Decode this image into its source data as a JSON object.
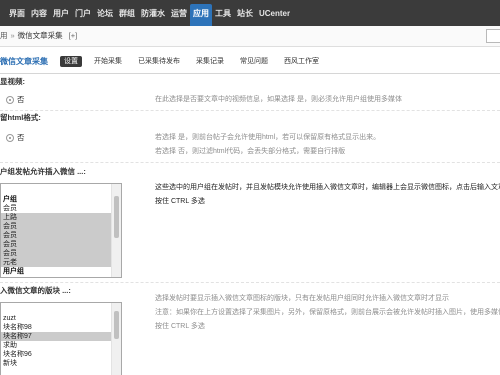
{
  "theme": {
    "nav_bg": "#3b3b3b",
    "accent": "#2d73b9",
    "plugin_title": "#2a6db2",
    "active_tab": "#3a3a3a",
    "selected_option": "#cbcbcb"
  },
  "nav": {
    "items": [
      {
        "label": "界面"
      },
      {
        "label": "内容"
      },
      {
        "label": "用户"
      },
      {
        "label": "门户"
      },
      {
        "label": "论坛"
      },
      {
        "label": "群组"
      },
      {
        "label": "防灌水"
      },
      {
        "label": "运营"
      },
      {
        "label": "应用",
        "active": true
      },
      {
        "label": "工具"
      },
      {
        "label": "站长"
      },
      {
        "label": "UCenter"
      }
    ]
  },
  "breadcrumb": {
    "parent": "用",
    "separator": "»",
    "current": "微信文章采集",
    "add_shortcut": "[+]"
  },
  "plugin": {
    "title": "微信文章采集",
    "tabs": [
      {
        "label": "设置",
        "active": true
      },
      {
        "label": "开始采集"
      },
      {
        "label": "已采集待发布"
      },
      {
        "label": "采集记录"
      },
      {
        "label": "常见问题"
      },
      {
        "label": "西风工作室"
      }
    ]
  },
  "settings": [
    {
      "label": "显视频:",
      "options": [
        {
          "label": "否",
          "checked": true
        }
      ],
      "description": [
        "在此选择是否要文章中的视频信息，如果选择 是，则必须允许用户组使用多媒体"
      ]
    },
    {
      "label": "留html格式:",
      "options": [
        {
          "label": "否",
          "checked": true
        }
      ],
      "description": [
        "若选择 是，则前台帖子会允许使用html，若可以保留原有格式显示出来。",
        "若选择 否，则过滤html代码，会丢失部分格式，需要自行排版"
      ]
    },
    {
      "label": "户组发帖允许插入微信 ...:",
      "options": [
        {
          "label": "户组",
          "group": true
        },
        {
          "label": "会员"
        },
        {
          "label": "上路",
          "selected": true
        },
        {
          "label": "会员",
          "selected": true
        },
        {
          "label": "会员",
          "selected": true
        },
        {
          "label": "会员",
          "selected": true
        },
        {
          "label": "会员",
          "selected": true
        },
        {
          "label": "元老",
          "selected": true
        },
        {
          "label": "用户组",
          "group": true
        }
      ],
      "description": [
        "这些选中的用户组在发帖时，并且发帖模块允许使用插入微信文章时，编辑器上会显示微信图标，点击后输入文章",
        "按住 CTRL 多选"
      ]
    },
    {
      "label": "入微信文章的版块 ...:",
      "options": [
        {
          "label": "zuzt"
        },
        {
          "label": "块名称98"
        },
        {
          "label": "块名称97",
          "selected": true
        },
        {
          "label": "求助"
        },
        {
          "label": "块名称96"
        },
        {
          "label": "新块"
        }
      ],
      "description": [
        "选择发帖时要显示插入微信文章图标的版块，只有在发帖用户组同时允许插入微信文章时才显示",
        "注意：如果你在上方设置选择了采集图片，另外，保留原格式，则前台展示会被允许发帖时插入图片，使用多媒体",
        "按住 CTRL 多选"
      ]
    }
  ]
}
